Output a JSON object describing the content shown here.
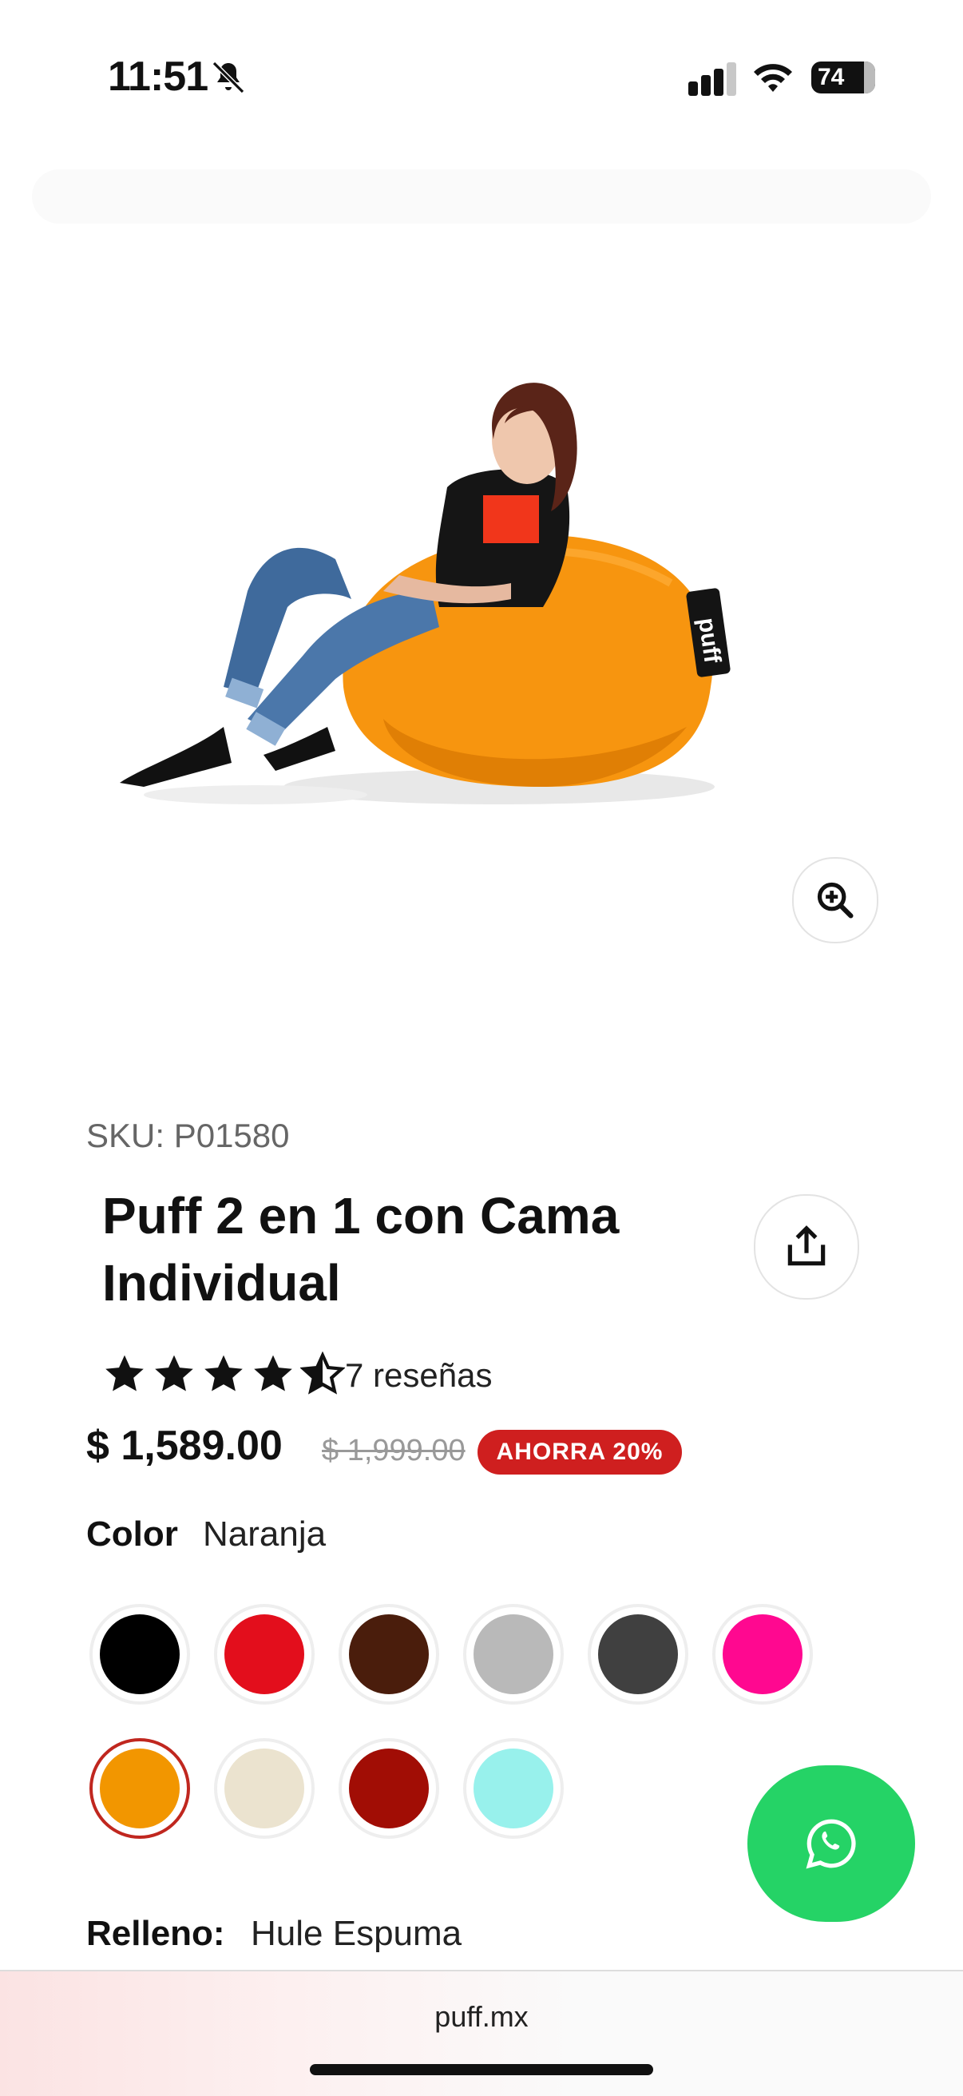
{
  "status": {
    "time": "11:51",
    "battery": "74"
  },
  "product": {
    "sku": "SKU: P01580",
    "title": "Puff 2 en 1 con Cama Individual",
    "rating": 4.5,
    "reviews": "7 reseñas",
    "price": "$ 1,589.00",
    "old_price": "$ 1,999.00",
    "discount_badge": "AHORRA 20%",
    "image_brand_tag": "puff"
  },
  "color": {
    "label": "Color",
    "selected": "Naranja",
    "swatches": [
      "#000000",
      "#e30e1c",
      "#4a1d0c",
      "#b9b9b9",
      "#404040",
      "#ff0890",
      "#f29600",
      "#ebe3cf",
      "#a10d05",
      "#98f1ec"
    ],
    "selected_index": 6
  },
  "fill": {
    "label": "Relleno:",
    "value": "Hule Espuma"
  },
  "browser": {
    "domain": "puff.mx"
  },
  "icons": {
    "bell": "bell-slash-icon",
    "zoom": "zoom-in-icon",
    "share": "share-icon",
    "whatsapp": "whatsapp-icon"
  }
}
